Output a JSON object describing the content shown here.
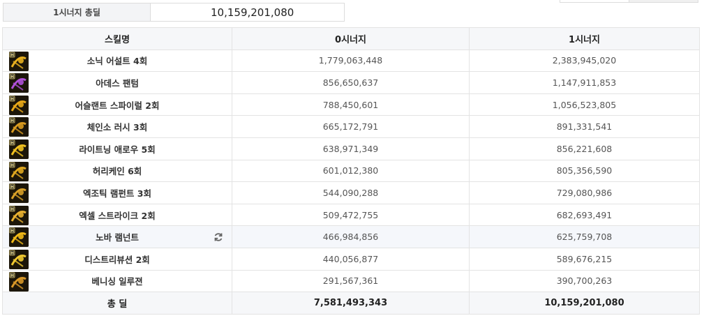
{
  "summary": {
    "label": "1시너지 총딜",
    "value": "10,159,201,080"
  },
  "table": {
    "headers": {
      "skill": "스킬명",
      "synergy0": "0시너지",
      "synergy1": "1시너지"
    },
    "rows": [
      {
        "name": "소닉 어설트 4회",
        "s0": "1,779,063,448",
        "s1": "2,383,945,020",
        "icon": "sonic-assault-icon",
        "color": "#e8b020"
      },
      {
        "name": "아데스 팬텀",
        "s0": "856,650,637",
        "s1": "1,147,911,853",
        "icon": "ades-phantom-icon",
        "color": "#b050d8"
      },
      {
        "name": "어슬랜트 스파이럴 2회",
        "s0": "788,450,601",
        "s1": "1,056,523,805",
        "icon": "aslant-spiral-icon",
        "color": "#e8a818"
      },
      {
        "name": "체인소 러시 3회",
        "s0": "665,172,791",
        "s1": "891,331,541",
        "icon": "chainsaw-rush-icon",
        "color": "#d89a20"
      },
      {
        "name": "라이트닝 애로우 5회",
        "s0": "638,971,349",
        "s1": "856,221,608",
        "icon": "lightning-arrow-icon",
        "color": "#f0c020"
      },
      {
        "name": "허리케인 6회",
        "s0": "601,012,380",
        "s1": "805,356,590",
        "icon": "hurricane-icon",
        "color": "#e0a820"
      },
      {
        "name": "엑조틱 램펀트 3회",
        "s0": "544,090,288",
        "s1": "729,080,986",
        "icon": "exotic-rampant-icon",
        "color": "#d8a028"
      },
      {
        "name": "엑셀 스트라이크 2회",
        "s0": "509,472,755",
        "s1": "682,693,491",
        "icon": "excel-strike-icon",
        "color": "#e8b030"
      },
      {
        "name": "노바 램넌트",
        "s0": "466,984,856",
        "s1": "625,759,708",
        "icon": "nova-remnant-icon",
        "color": "#f0b818",
        "highlight": true
      },
      {
        "name": "디스트리뷰션 2회",
        "s0": "440,056,877",
        "s1": "589,676,215",
        "icon": "distribution-icon",
        "color": "#f0c830"
      },
      {
        "name": "베니싱 일루젼",
        "s0": "291,567,361",
        "s1": "390,700,263",
        "icon": "vanishing-illusion-icon",
        "color": "#d89828"
      }
    ],
    "footer": {
      "label": "총 딜",
      "s0": "7,581,493,343",
      "s1": "10,159,201,080"
    }
  },
  "refresh_icon": "refresh-icon",
  "colors": {
    "header_bg": "#f6f7f9",
    "border": "#e3e3e3",
    "highlight_row": "#f5f7fb"
  }
}
